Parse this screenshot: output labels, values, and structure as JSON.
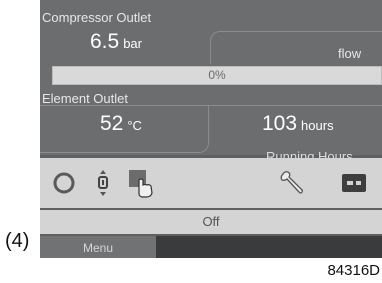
{
  "compressor": {
    "label": "Compressor Outlet",
    "value": "6.5",
    "unit": "bar",
    "flow_label": "flow"
  },
  "progress": {
    "text": "0%",
    "value": 0
  },
  "element": {
    "label": "Element Outlet",
    "value": "52",
    "unit": "°C"
  },
  "hours": {
    "value": "103",
    "unit": "hours",
    "label": "Running Hours"
  },
  "icons": [
    "status-circle-icon",
    "pressure-adjust-icon",
    "hand-touch-icon",
    "wrench-icon",
    "message-icon"
  ],
  "status": {
    "text": "Off"
  },
  "menu": {
    "label": "Menu"
  },
  "figure": {
    "label": "(4)",
    "code": "84316D"
  }
}
